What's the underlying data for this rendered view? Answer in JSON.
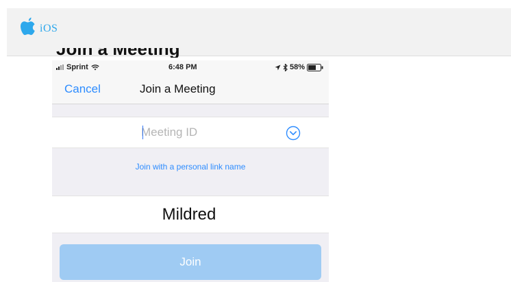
{
  "banner": {
    "icon": "apple-icon",
    "label": "iOS",
    "cutoff_heading": "Join a Meeting"
  },
  "status_bar": {
    "carrier": "Sprint",
    "time": "6:48 PM",
    "battery": "58%",
    "icons": [
      "signal-icon",
      "wifi-icon",
      "location-icon",
      "bluetooth-icon",
      "battery-icon"
    ]
  },
  "nav": {
    "cancel_label": "Cancel",
    "title": "Join a Meeting"
  },
  "meeting_id": {
    "placeholder": "Meeting ID",
    "value": ""
  },
  "personal_link_label": "Join with a personal link name",
  "name_field": {
    "value": "Mildred"
  },
  "join_label": "Join",
  "colors": {
    "accent": "#2d8cff",
    "ios_label": "#2ea8ec",
    "join_disabled": "#9fcbf3",
    "background": "#f0eff4"
  }
}
